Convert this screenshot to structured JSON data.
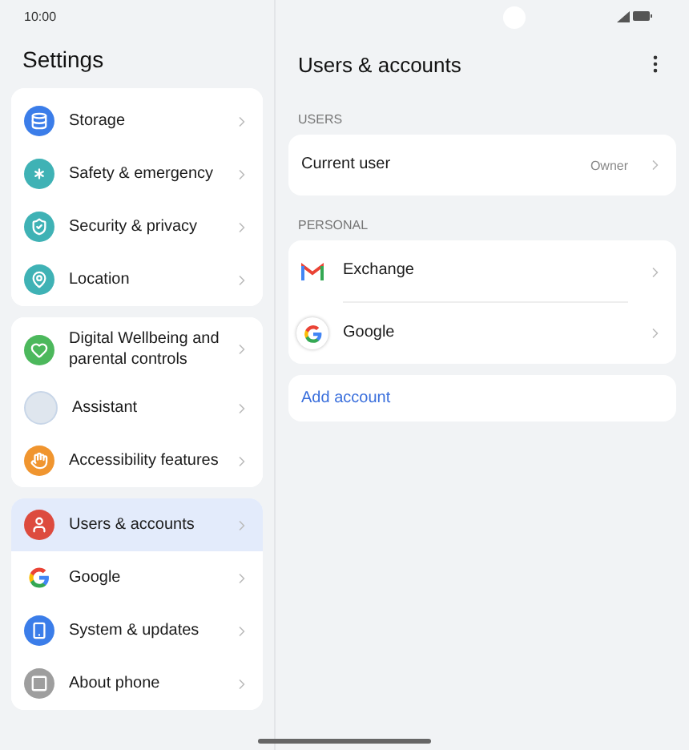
{
  "status_bar": {
    "time": "10:00"
  },
  "sidebar": {
    "title": "Settings",
    "groups": [
      [
        {
          "label": "Storage",
          "color": "#3b7de9",
          "selected": false
        },
        {
          "label": "Safety & emergency",
          "color": "#3fb2b5",
          "selected": false
        },
        {
          "label": "Security & privacy",
          "color": "#3fb2b5",
          "selected": false
        },
        {
          "label": "Location",
          "color": "#3fb2b5",
          "selected": false
        }
      ],
      [
        {
          "label": "Digital Wellbeing and parental controls",
          "color": "#4cb85c",
          "selected": false
        },
        {
          "label": "Assistant",
          "color": "#dfe6ee",
          "selected": false
        },
        {
          "label": "Accessibility features",
          "color": "#f0952f",
          "selected": false
        }
      ],
      [
        {
          "label": "Users & accounts",
          "color": "#dd4b3e",
          "selected": true
        },
        {
          "label": "Google",
          "color": "#ffffff",
          "selected": false
        },
        {
          "label": "System & updates",
          "color": "#3b7de9",
          "selected": false
        },
        {
          "label": "About phone",
          "color": "#9e9e9e",
          "selected": false
        }
      ]
    ]
  },
  "detail": {
    "title": "Users & accounts",
    "sections": [
      {
        "header": "USERS",
        "rows": [
          {
            "label": "Current user",
            "value": "Owner"
          }
        ]
      },
      {
        "header": "PERSONAL",
        "rows": [
          {
            "label": "Exchange"
          },
          {
            "label": "Google"
          }
        ]
      }
    ],
    "add_account": "Add account"
  }
}
